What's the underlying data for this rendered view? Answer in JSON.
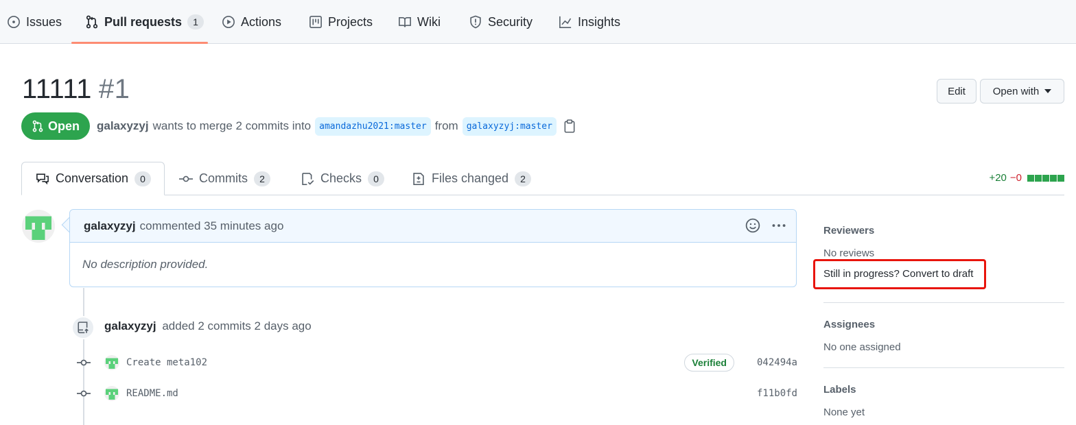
{
  "repo_nav": {
    "issues": "Issues",
    "pull_requests": "Pull requests",
    "pull_requests_count": "1",
    "actions": "Actions",
    "projects": "Projects",
    "wiki": "Wiki",
    "security": "Security",
    "insights": "Insights"
  },
  "pr": {
    "title": "11111",
    "number": "#1",
    "edit_label": "Edit",
    "open_with_label": "Open with",
    "state": "Open",
    "author": "galaxyzyj",
    "merge_text": "wants to merge 2 commits into",
    "base_branch": "amandazhu2021:master",
    "from_text": "from",
    "head_branch": "galaxyzyj:master"
  },
  "tabs": {
    "conversation": "Conversation",
    "conversation_count": "0",
    "commits": "Commits",
    "commits_count": "2",
    "checks": "Checks",
    "checks_count": "0",
    "files_changed": "Files changed",
    "files_changed_count": "2",
    "additions": "+20",
    "deletions": "−0"
  },
  "comment": {
    "author": "galaxyzyj",
    "meta": "commented 35 minutes ago",
    "body": "No description provided."
  },
  "push_event": {
    "author": "galaxyzyj",
    "text": "added 2 commits 2 days ago"
  },
  "commits": [
    {
      "message": "Create meta102",
      "verified": "Verified",
      "sha": "042494a"
    },
    {
      "message": "README.md",
      "sha": "f11b0fd"
    }
  ],
  "sidebar": {
    "reviewers_heading": "Reviewers",
    "reviewers_value": "No reviews",
    "draft_link": "Still in progress? Convert to draft",
    "assignees_heading": "Assignees",
    "assignees_value": "No one assigned",
    "labels_heading": "Labels",
    "labels_value": "None yet"
  },
  "colors": {
    "accent_underline": "#fd8c73",
    "open_green": "#2da44e",
    "highlight_red": "#e8140c",
    "link_blue": "#0969da"
  }
}
